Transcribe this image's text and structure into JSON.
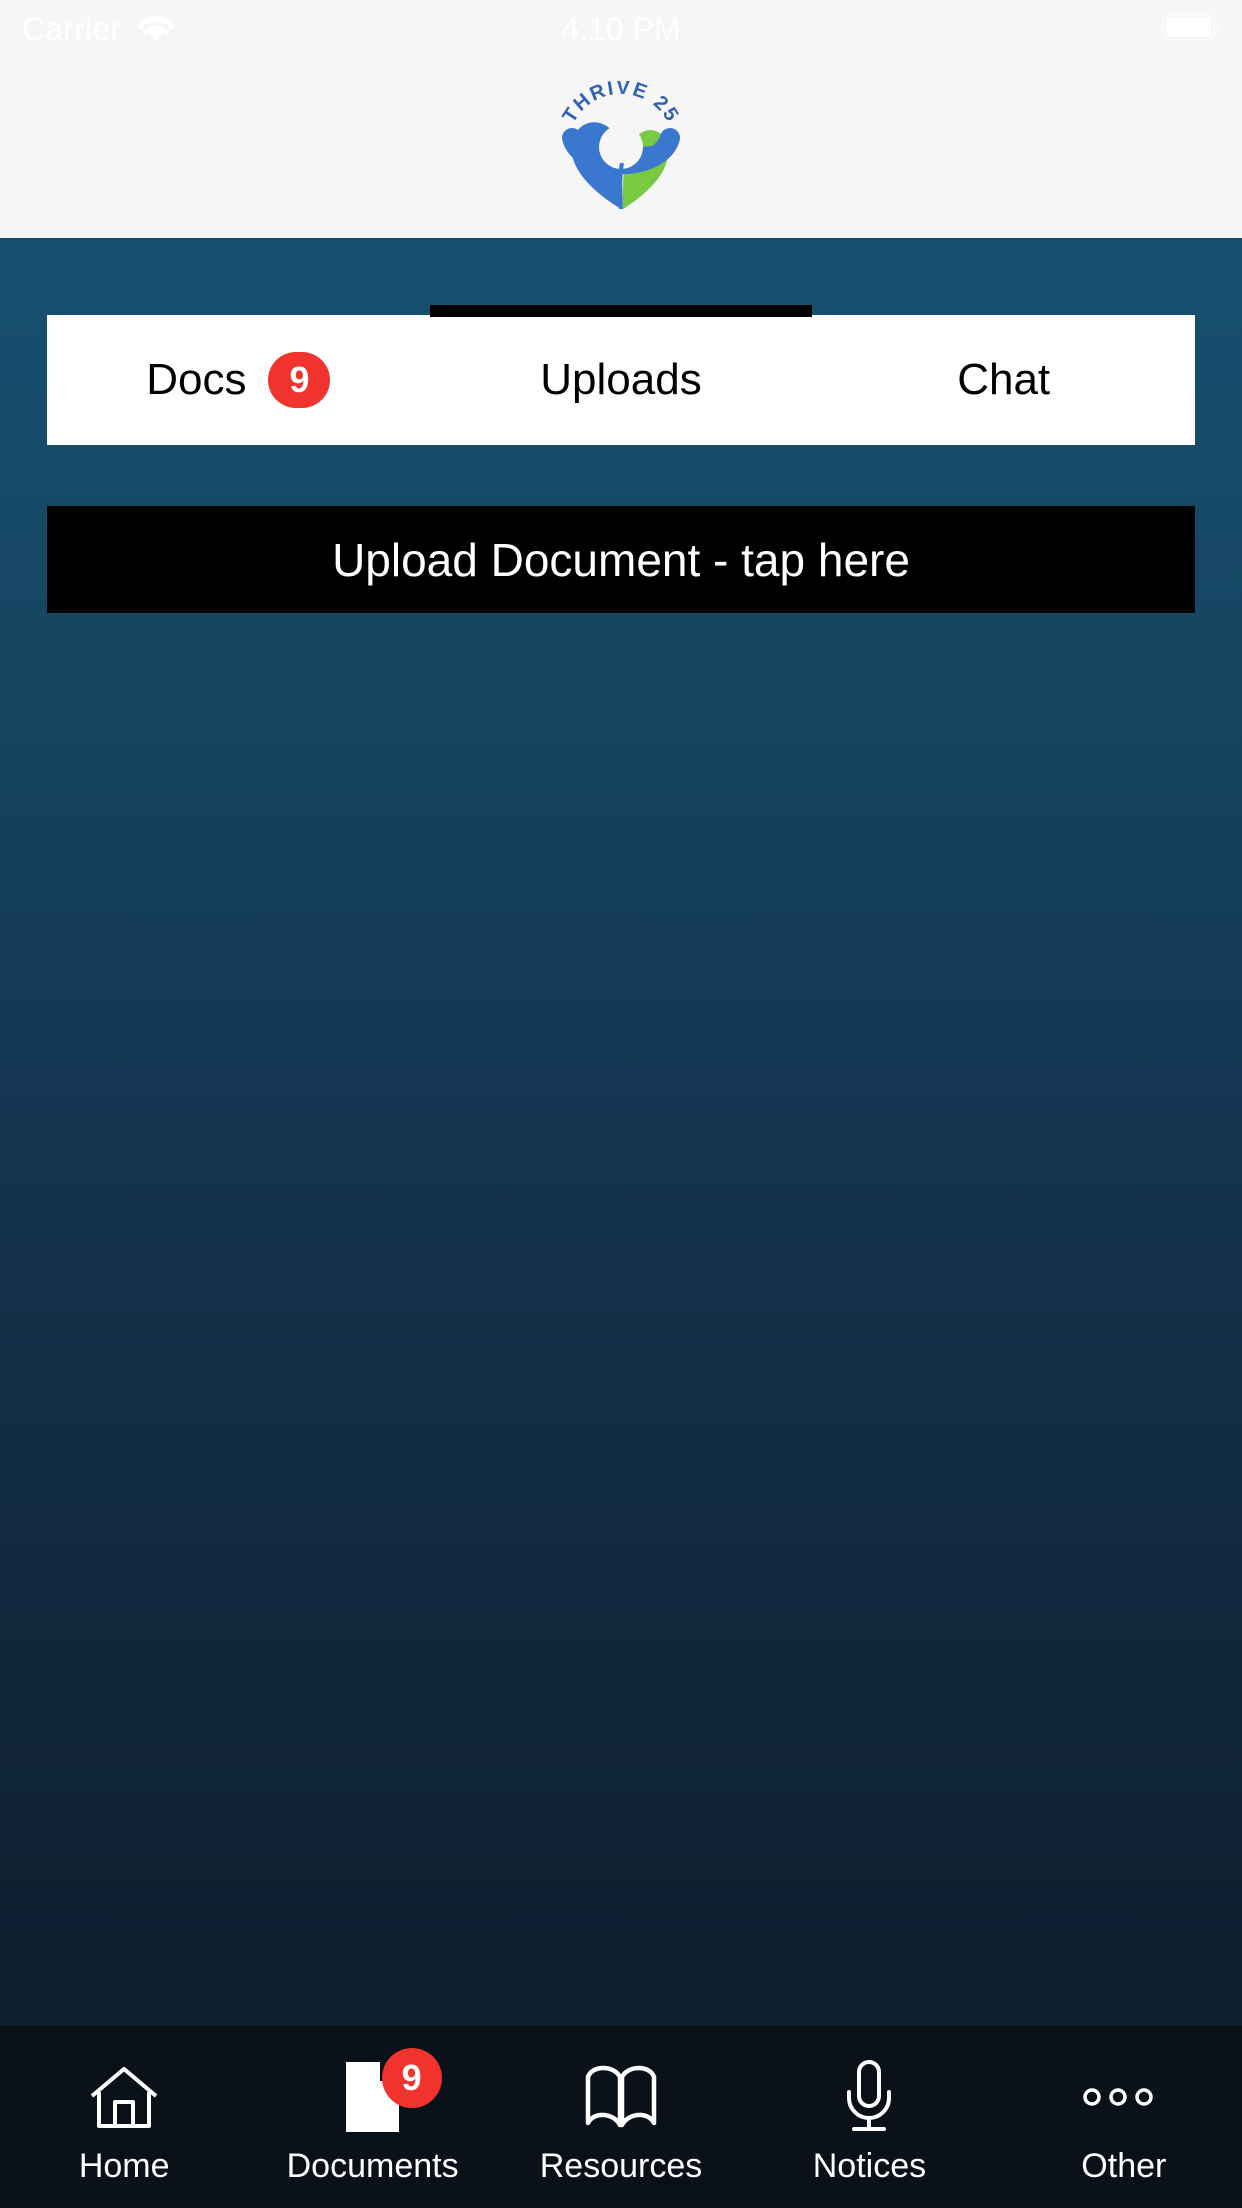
{
  "status_bar": {
    "carrier": "Carrier",
    "time": "4:10 PM",
    "wifi_icon": "wifi-icon",
    "battery_icon": "battery-full-icon",
    "text_color": "#ffffff",
    "background": "#f6f6f6"
  },
  "header": {
    "logo_icon": "thrive-25-logo",
    "logo_text": "THRIVE 25",
    "background": "#f6f6f6",
    "logo_blue": "#3a78cf",
    "logo_green": "#7ac943"
  },
  "colors": {
    "accent_blue_top": "#17506f",
    "accent_blue_bottom": "#0d1e2e",
    "badge_red": "#f0332c",
    "nav_background": "#0a1119",
    "tab_card_background": "#ffffff",
    "active_indicator": "#000000"
  },
  "tabs": {
    "items": [
      {
        "label": "Docs",
        "badge": "9",
        "active": false
      },
      {
        "label": "Uploads",
        "badge": "",
        "active": true
      },
      {
        "label": "Chat",
        "badge": "",
        "active": false
      }
    ]
  },
  "upload": {
    "button_label": "Upload Document - tap here"
  },
  "bottom_nav": {
    "items": [
      {
        "label": "Home",
        "icon": "home-icon",
        "badge": "",
        "active": false
      },
      {
        "label": "Documents",
        "icon": "document-icon",
        "badge": "9",
        "active": true
      },
      {
        "label": "Resources",
        "icon": "book-icon",
        "badge": "",
        "active": false
      },
      {
        "label": "Notices",
        "icon": "microphone-icon",
        "badge": "",
        "active": false
      },
      {
        "label": "Other",
        "icon": "more-dots-icon",
        "badge": "",
        "active": false
      }
    ]
  }
}
